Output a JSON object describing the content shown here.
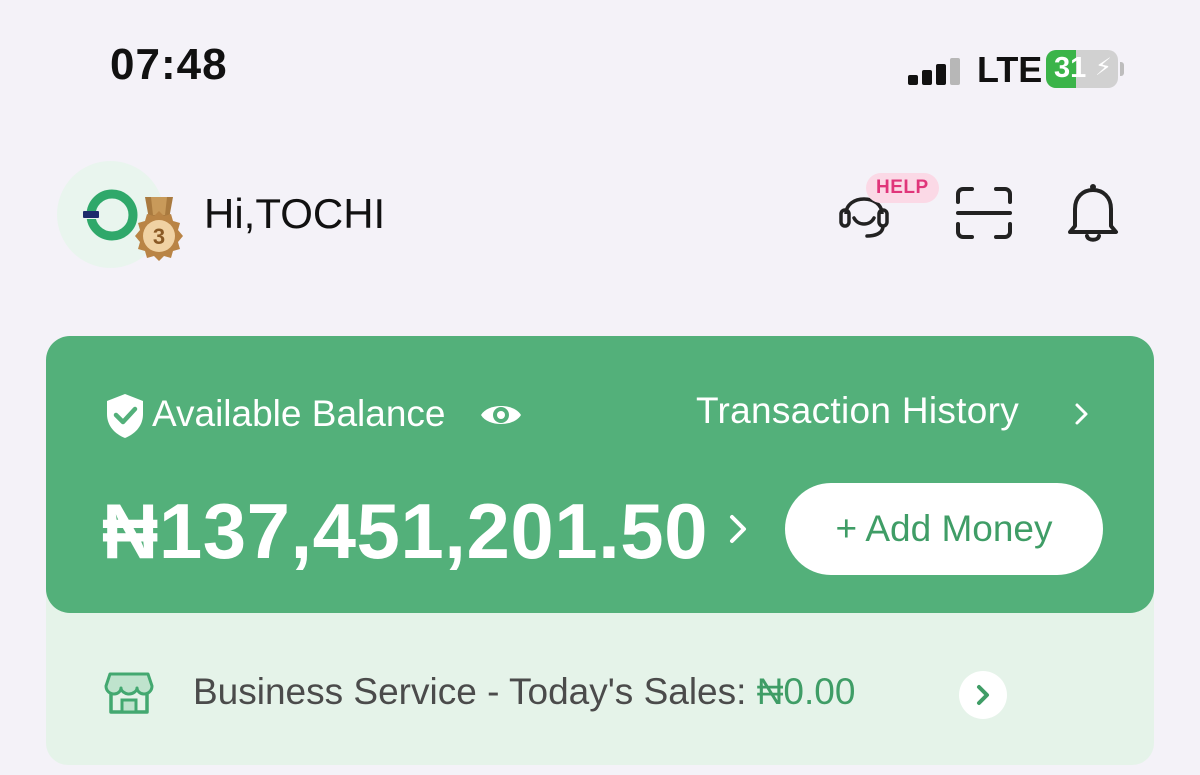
{
  "status_bar": {
    "time": "07:48",
    "network": "LTE",
    "battery_percent": "31",
    "icons": [
      "signal-icon",
      "battery-icon",
      "charging-bolt-icon"
    ]
  },
  "header": {
    "greeting": "Hi,TOCHI",
    "medal_level": "3",
    "help_badge": "HELP",
    "icons": [
      "avatar-logo",
      "medal-icon",
      "support-headset-icon",
      "scan-icon",
      "bell-icon"
    ]
  },
  "balance_card": {
    "label": "Available Balance",
    "transaction_history": "Transaction History",
    "amount": "₦137,451,201.50",
    "add_money": "+ Add Money",
    "icons": [
      "shield-check-icon",
      "eye-icon",
      "chevron-right-icon"
    ]
  },
  "business": {
    "label": "Business Service - Today's Sales: ",
    "value": "₦0.00",
    "icons": [
      "store-icon",
      "chevron-right-icon"
    ]
  },
  "colors": {
    "brand_green": "#53b07a",
    "light_green": "#e5f3e9",
    "background": "#f4f2f8",
    "help_pink": "#e0357a",
    "battery_green": "#3bb449"
  }
}
